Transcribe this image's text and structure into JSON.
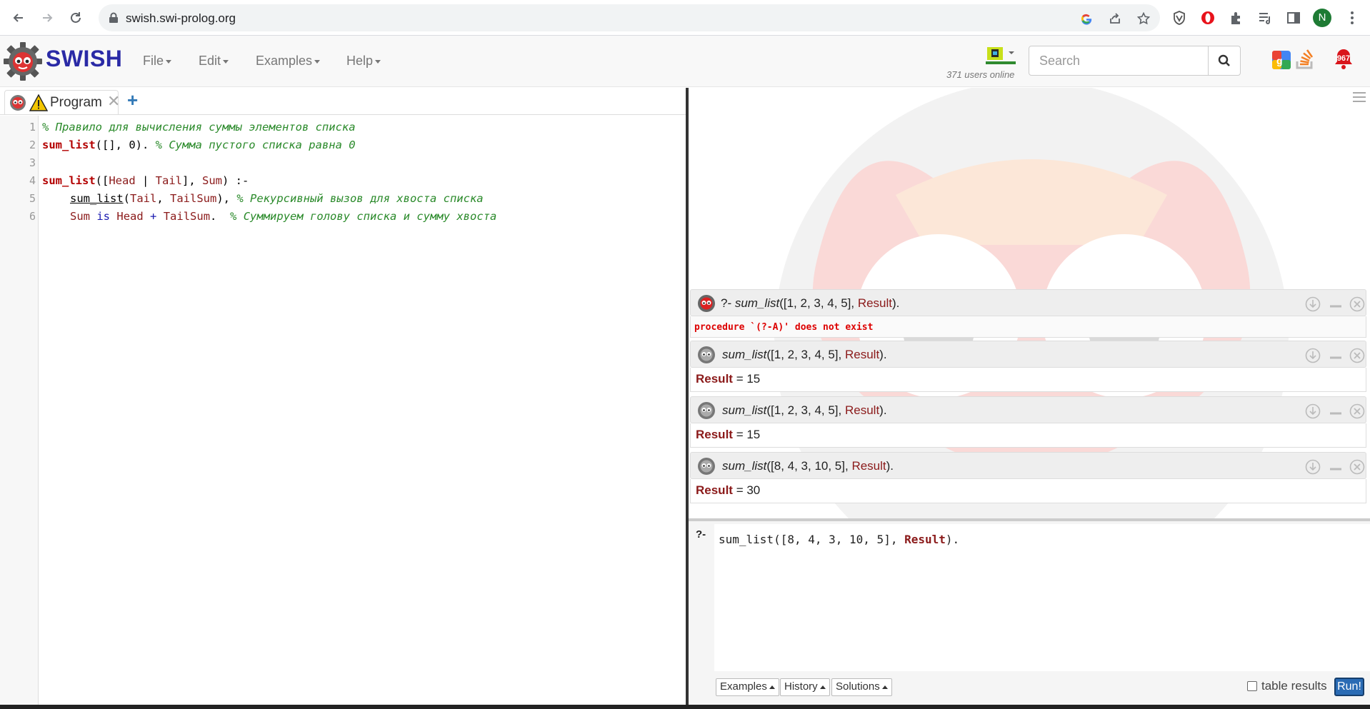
{
  "browser": {
    "url": "swish.swi-prolog.org",
    "profile_initial": "N",
    "profile_color": "#1e7b34"
  },
  "navbar": {
    "brand": "SWISH",
    "menus": [
      "File",
      "Edit",
      "Examples",
      "Help"
    ],
    "users_online": "371 users online",
    "search_placeholder": "Search",
    "notifications_count": "967"
  },
  "program": {
    "tab_label": "Program",
    "line_numbers": [
      "1",
      "2",
      "3",
      "4",
      "5",
      "6"
    ],
    "lines": {
      "l1_comment": "% Правило для вычисления суммы элементов списка",
      "l2_head": "sum_list",
      "l2_args": "([], 0). ",
      "l2_comment": "% Сумма пустого списка равна 0",
      "l4_head": "sum_list",
      "l4_open": "([",
      "l4_head_var": "Head",
      "l4_bar": " | ",
      "l4_tail_var": "Tail",
      "l4_mid": "], ",
      "l4_sum_var": "Sum",
      "l4_end": ") :-",
      "l5_goal": "sum_list",
      "l5_open": "(",
      "l5_tail_var": "Tail",
      "l5_comma": ", ",
      "l5_tailsum_var": "TailSum",
      "l5_end": "), ",
      "l5_comment": "% Рекурсивный вызов для хвоста списка",
      "l6_sum_var": "Sum",
      "l6_is": "is",
      "l6_head_var": "Head",
      "l6_plus": "+",
      "l6_tailsum_var": "TailSum",
      "l6_dot": ".  ",
      "l6_comment": "% Суммируем голову списка и сумму хвоста"
    }
  },
  "answers": [
    {
      "prefix": "?- ",
      "pred": "sum_list",
      "args": "([1, 2, 3, 4, 5], ",
      "result_var": "Result",
      "close": ").",
      "error": "procedure `(?-A)' does not exist"
    },
    {
      "pred": "sum_list",
      "args": "([1, 2, 3, 4, 5], ",
      "result_var": "Result",
      "close": ").",
      "binding_var": "Result",
      "binding_eq": " = 15"
    },
    {
      "pred": "sum_list",
      "args": "([1, 2, 3, 4, 5], ",
      "result_var": "Result",
      "close": ").",
      "binding_var": "Result",
      "binding_eq": " = 15"
    },
    {
      "pred": "sum_list",
      "args": "([8, 4, 3, 10, 5], ",
      "result_var": "Result",
      "close": ").",
      "binding_var": "Result",
      "binding_eq": " = 30"
    }
  ],
  "query": {
    "prompt": "?-",
    "text_before": "sum_list([8, 4, 3, 10, 5], ",
    "text_var": "Result",
    "text_after": ").",
    "examples_label": "Examples",
    "history_label": "History",
    "solutions_label": "Solutions",
    "table_results_label": "table results",
    "run_label": "Run!"
  }
}
